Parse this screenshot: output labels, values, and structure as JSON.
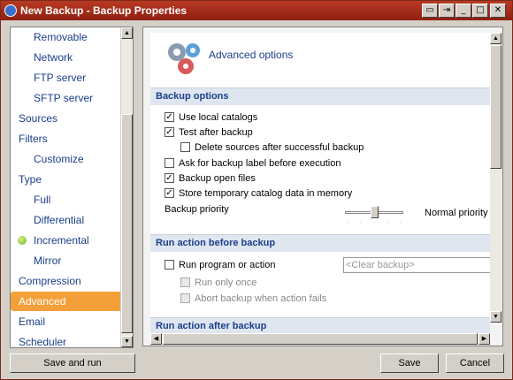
{
  "window": {
    "title": "New Backup - Backup Properties"
  },
  "sidebar": {
    "items": [
      {
        "label": "Removable",
        "indent": true
      },
      {
        "label": "Network",
        "indent": true
      },
      {
        "label": "FTP server",
        "indent": true
      },
      {
        "label": "SFTP server",
        "indent": true
      },
      {
        "label": "Sources",
        "indent": false
      },
      {
        "label": "Filters",
        "indent": false
      },
      {
        "label": "Customize",
        "indent": true
      },
      {
        "label": "Type",
        "indent": false
      },
      {
        "label": "Full",
        "indent": true
      },
      {
        "label": "Differential",
        "indent": true
      },
      {
        "label": "Incremental",
        "indent": true,
        "icon": "green-dot-icon"
      },
      {
        "label": "Mirror",
        "indent": true
      },
      {
        "label": "Compression",
        "indent": false
      },
      {
        "label": "Advanced",
        "indent": false,
        "selected": true
      },
      {
        "label": "Email",
        "indent": false
      },
      {
        "label": "Scheduler",
        "indent": false
      }
    ]
  },
  "main": {
    "page_title": "Advanced options",
    "sections": {
      "backup_options": {
        "title": "Backup options",
        "options": [
          {
            "label": "Use local catalogs",
            "checked": true
          },
          {
            "label": "Test after backup",
            "checked": true
          },
          {
            "label": "Delete sources after successful backup",
            "checked": false
          },
          {
            "label": "Ask for backup label before execution",
            "checked": false
          },
          {
            "label": "Backup open files",
            "checked": true
          },
          {
            "label": "Store temporary catalog data in memory",
            "checked": true
          }
        ],
        "priority_label": "Backup priority",
        "priority_value": "Normal priority",
        "priority_level": 0.5
      },
      "run_before": {
        "title": "Run action before backup",
        "run_program_label": "Run program or action",
        "action_placeholder": "<Clear backup>",
        "run_only_once_label": "Run only once",
        "abort_label": "Abort backup when action fails"
      },
      "run_after": {
        "title": "Run action after backup"
      }
    }
  },
  "buttons": {
    "save_and_run": "Save and run",
    "save": "Save",
    "cancel": "Cancel"
  },
  "colors": {
    "title_bar": "#a02a18",
    "selection": "#f4a03a",
    "link_text": "#1a3e8a",
    "section_header_bg": "#dfe6f0"
  }
}
